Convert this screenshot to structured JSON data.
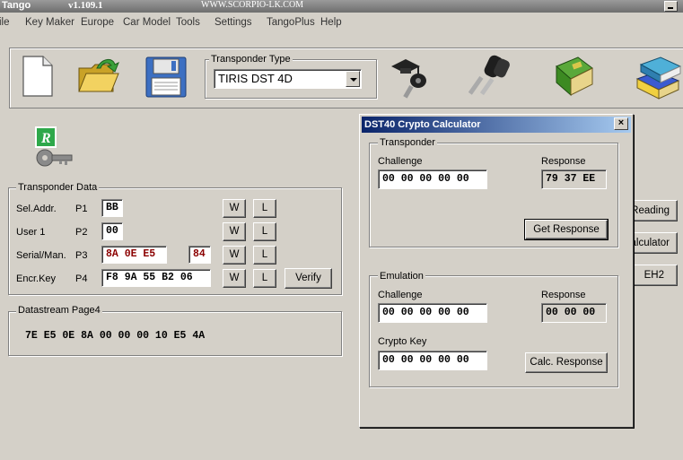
{
  "window": {
    "app_name": "Tango",
    "version": "v1.109.1",
    "website": "WWW.SCORPIO-LK.COM"
  },
  "menu": [
    "ile",
    "Key Maker",
    "Europe",
    "Car Model",
    "Tools",
    "Settings",
    "TangoPlus",
    "Help"
  ],
  "toolbar": {
    "transponder_type_label": "Transponder Type",
    "transponder_type_value": "TIRIS DST 4D",
    "icons": [
      "new-file-icon",
      "open-folder-icon",
      "save-floppy-icon",
      "key-graduation-icon",
      "car-keys-icon",
      "green-book-icon",
      "books-stack-icon"
    ]
  },
  "transponder_data": {
    "title": "Transponder Data",
    "rows": [
      {
        "label": "Sel.Addr.",
        "page": "P1",
        "value": "BB"
      },
      {
        "label": "User 1",
        "page": "P2",
        "value": "00"
      },
      {
        "label": "Serial/Man.",
        "page": "P3",
        "value": "8A 0E E5",
        "value2": "84"
      },
      {
        "label": "Encr.Key",
        "page": "P4",
        "value": "F8 9A 55 B2 06"
      }
    ],
    "write_label": "W",
    "load_label": "L",
    "verify_label": "Verify"
  },
  "datastream": {
    "title": "Datastream Page4",
    "value": "7E E5 0E 8A 00 00 00 10 E5 4A"
  },
  "right_buttons": [
    "Reading",
    "alculator",
    "EH2"
  ],
  "dialog": {
    "title": "DST40 Crypto Calculator",
    "close": "×",
    "transponder": {
      "title": "Transponder",
      "challenge_label": "Challenge",
      "challenge_value": "00 00 00 00 00",
      "response_label": "Response",
      "response_value": "79 37 EE",
      "button": "Get Response"
    },
    "emulation": {
      "title": "Emulation",
      "challenge_label": "Challenge",
      "challenge_value": "00 00 00 00 00",
      "response_label": "Response",
      "response_value": "00 00 00",
      "crypto_key_label": "Crypto Key",
      "crypto_key_value": "00 00 00 00 00",
      "button": "Calc. Response"
    }
  }
}
